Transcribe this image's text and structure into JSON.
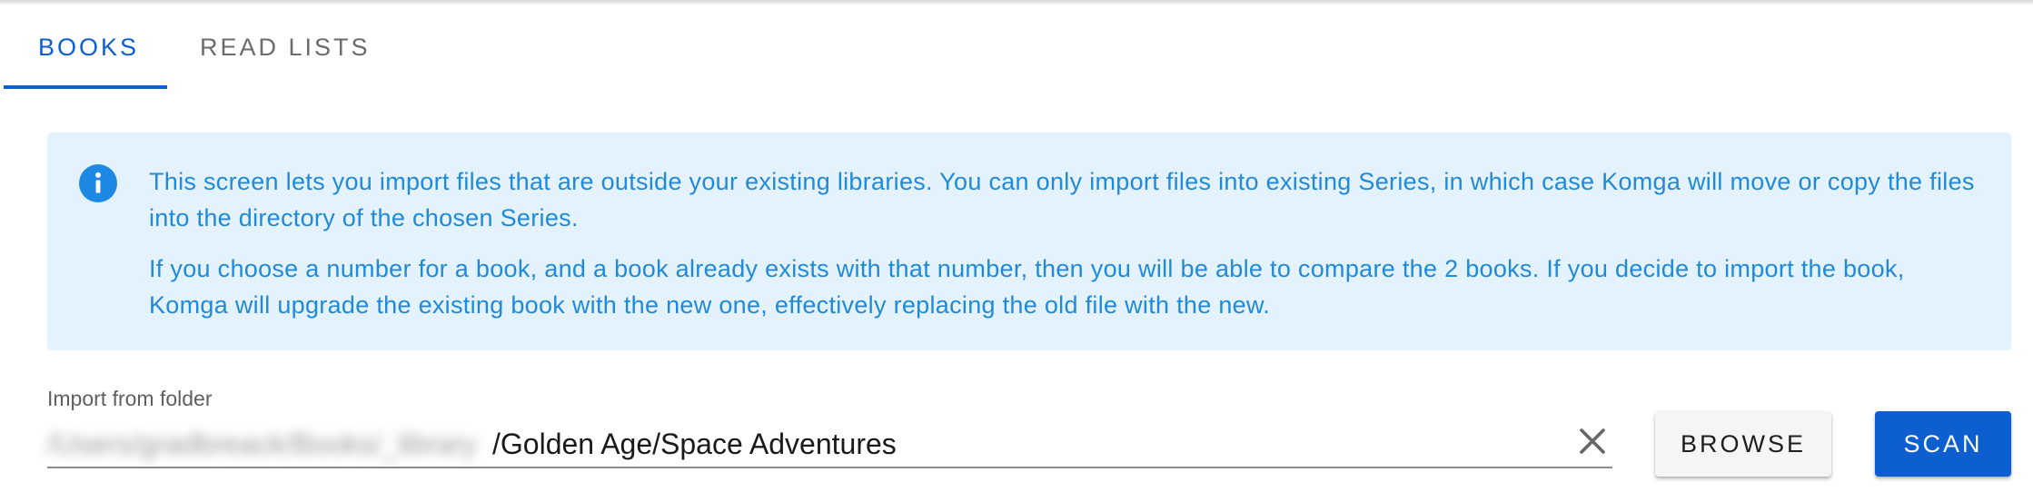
{
  "tabs": [
    {
      "label": "BOOKS",
      "active": true
    },
    {
      "label": "READ LISTS",
      "active": false
    }
  ],
  "alert": {
    "icon": "info-icon",
    "paragraph_1": "This screen lets you import files that are outside your existing libraries. You can only import files into existing Series, in which case Komga will move or copy the files into the directory of the chosen Series.",
    "paragraph_2": "If you choose a number for a book, and a book already exists with that number, then you will be able to compare the 2 books. If you decide to import the book, Komga will upgrade the existing book with the new one, effectively replacing the old file with the new."
  },
  "import_field": {
    "label": "Import from folder",
    "value_redacted": "/Users/gradbreack/Books/_library",
    "value_visible": "/Golden Age/Space Adventures",
    "clear_icon": "close-icon"
  },
  "buttons": {
    "browse": "BROWSE",
    "scan": "SCAN"
  },
  "colors": {
    "accent": "#0d5fcf",
    "alert_bg": "#e4f2fd",
    "alert_text": "#1f8ad9",
    "info_icon": "#1e88e5"
  }
}
